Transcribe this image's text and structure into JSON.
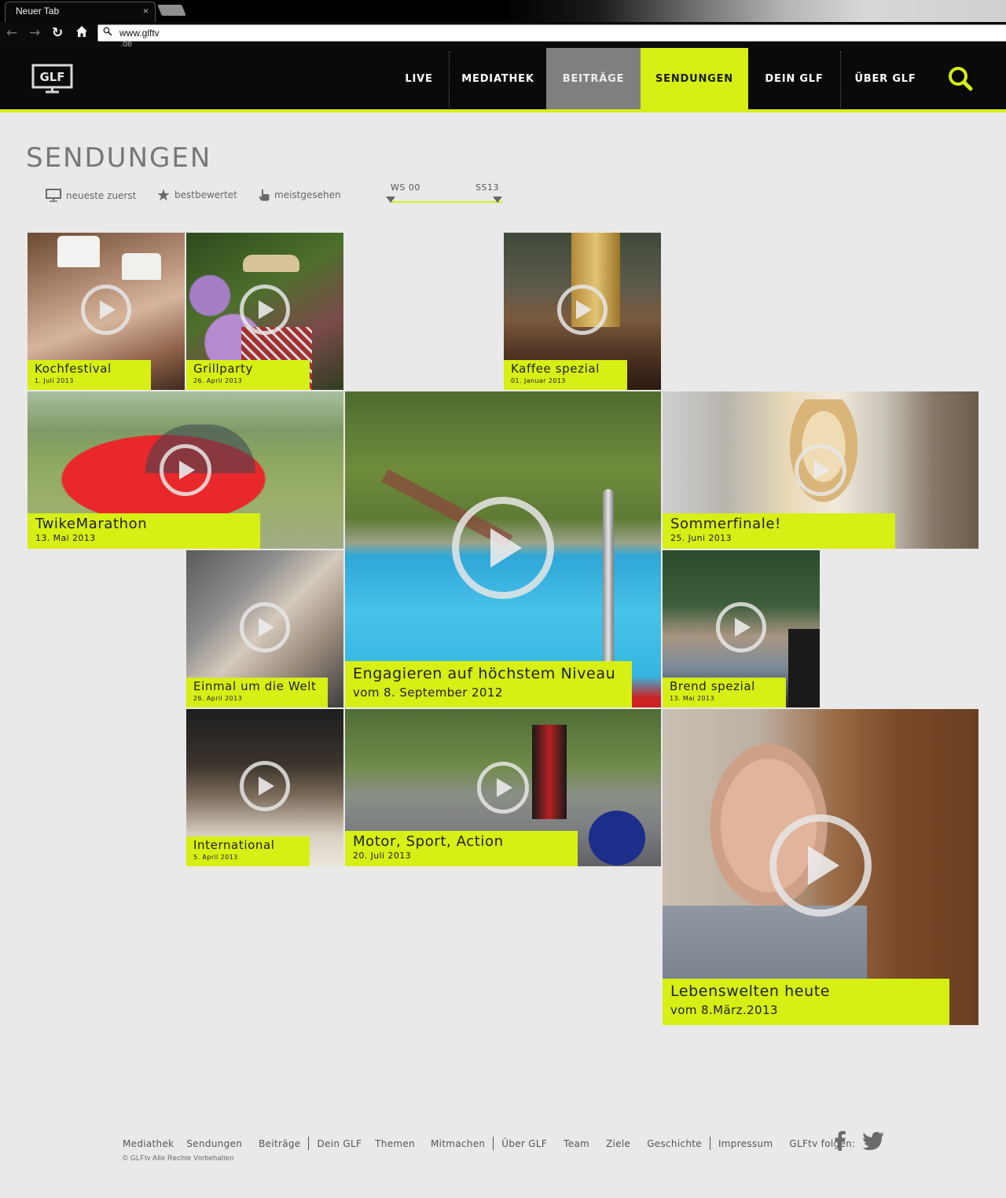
{
  "browser": {
    "tab_title": "Neuer Tab",
    "tab_close": "×",
    "url": "www.glftv",
    "url_continued": ".de"
  },
  "header": {
    "logo_text": "GLF",
    "nav": [
      {
        "label": "LIVE",
        "state": "normal"
      },
      {
        "label": "MEDIATHEK",
        "state": "normal"
      },
      {
        "label": "BEITRÄGE",
        "state": "hover"
      },
      {
        "label": "SENDUNGEN",
        "state": "active"
      },
      {
        "label": "DEIN GLF",
        "state": "normal"
      },
      {
        "label": "ÜBER GLF",
        "state": "normal"
      }
    ],
    "search_icon": "search-icon",
    "accent_color": "#d6ef14"
  },
  "page": {
    "title": "SENDUNGEN",
    "sort_options": [
      {
        "label": "neueste zuerst",
        "icon": "monitor-icon"
      },
      {
        "label": "bestbewertet",
        "icon": "star-icon"
      },
      {
        "label": "meistgesehen",
        "icon": "hand-pointer-icon"
      }
    ],
    "range": {
      "from": "WS 00",
      "to": "SS13"
    }
  },
  "shows": [
    {
      "title": "Kochfestival",
      "date": "1. Juli 2013"
    },
    {
      "title": "Grillparty",
      "date": "26. April 2013"
    },
    {
      "title": "Kaffee spezial",
      "date": "01. Januar 2013"
    },
    {
      "title": "TwikeMarathon",
      "date": "13. Mai 2013"
    },
    {
      "title": "Engagieren auf höchstem Niveau",
      "date": "vom 8. September 2012"
    },
    {
      "title": "Sommerfinale!",
      "date": "25. Juni 2013"
    },
    {
      "title": "Einmal um die Welt",
      "date": "26. April 2013"
    },
    {
      "title": "Brend spezial",
      "date": "13. Mai 2013"
    },
    {
      "title": "International",
      "date": "5. April 2013"
    },
    {
      "title": "Motor, Sport, Action",
      "date": "20. Juli 2013"
    },
    {
      "title": "Lebenswelten heute",
      "date": "vom 8.März.2013"
    }
  ],
  "footer": {
    "links": [
      "Mediathek",
      "Sendungen",
      "Beiträge",
      "Dein GLF",
      "Themen",
      "Mitmachen",
      "Über GLF",
      "Team",
      "Ziele",
      "Geschichte",
      "Impressum"
    ],
    "follow_label": "GLFtv folgen:",
    "copyright": "© GLFtv Alle Rechte Vorbehalten",
    "social": [
      "facebook-icon",
      "twitter-icon"
    ]
  }
}
